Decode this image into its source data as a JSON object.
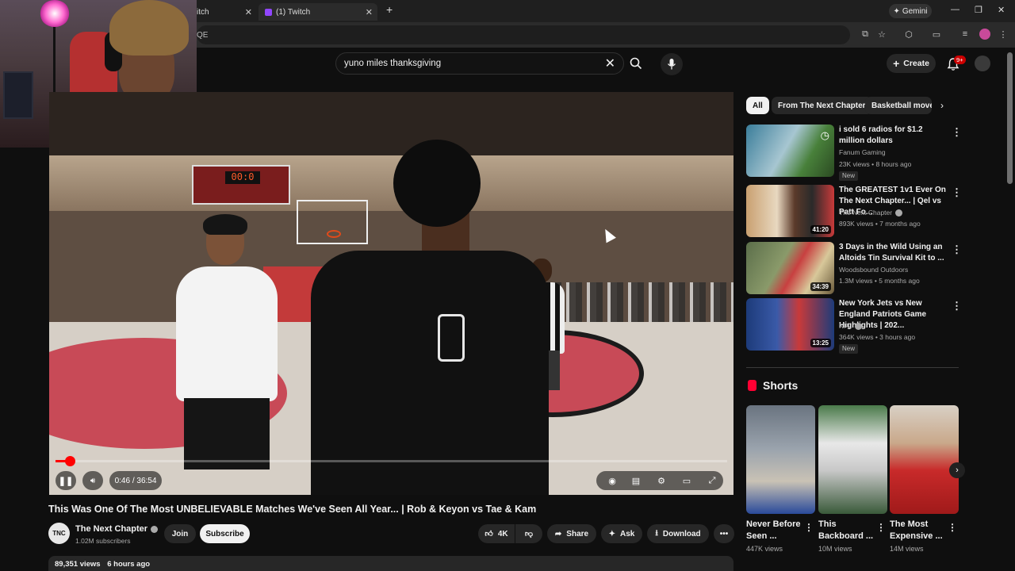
{
  "browser": {
    "tabs": [
      {
        "label": "itch"
      },
      {
        "label": "(1) Twitch"
      }
    ],
    "new_tab": "+",
    "gemini": "Gemini",
    "url_fragment": "QE"
  },
  "header": {
    "search_value": "yuno miles thanksgiving",
    "create_label": "Create",
    "notification_count": "9+"
  },
  "player": {
    "time": "0:46 / 36:54",
    "progress_fraction": 0.0213,
    "scoreboard_time": "00:0",
    "scoreboard_period": "0"
  },
  "video": {
    "title": "This Was One Of The Most UNBELIEVABLE Matches We've Seen All Year... | Rob & Keyon vs Tae & Kam",
    "channel_name": "The Next Chapter",
    "channel_avatar_text": "TNC",
    "subscribers": "1.02M subscribers",
    "join_label": "Join",
    "subscribe_label": "Subscribe",
    "likes": "4K",
    "share_label": "Share",
    "ask_label": "Ask",
    "download_label": "Download",
    "views": "89,351 views",
    "posted": "6 hours ago"
  },
  "chips": [
    "All",
    "From The Next Chapter",
    "Basketball moves"
  ],
  "recommendations": [
    {
      "title": "i sold 6 radios for $1.2 million dollars",
      "channel": "Fanum Gaming",
      "meta": "23K views • 8 hours ago",
      "badge": "New",
      "duration": ""
    },
    {
      "title": "The GREATEST 1v1 Ever On The Next Chapter... | Qel vs Patt Fo...",
      "channel": "The Next Chapter",
      "meta": "893K views • 7 months ago",
      "badge": "",
      "duration": "41:20"
    },
    {
      "title": "3 Days in the Wild Using an Altoids Tin Survival Kit to ...",
      "channel": "Woodsbound Outdoors",
      "meta": "1.3M views • 5 months ago",
      "badge": "",
      "duration": "34:39"
    },
    {
      "title": "New York Jets vs New England Patriots Game Highlights | 202...",
      "channel": "NFL",
      "meta": "364K views • 3 hours ago",
      "badge": "New",
      "duration": "13:25"
    }
  ],
  "shorts": {
    "heading": "Shorts",
    "items": [
      {
        "title": "Never Before Seen ...",
        "views": "447K views"
      },
      {
        "title": "This Backboard ...",
        "views": "10M views"
      },
      {
        "title": "The Most Expensive ...",
        "views": "14M views"
      }
    ]
  }
}
